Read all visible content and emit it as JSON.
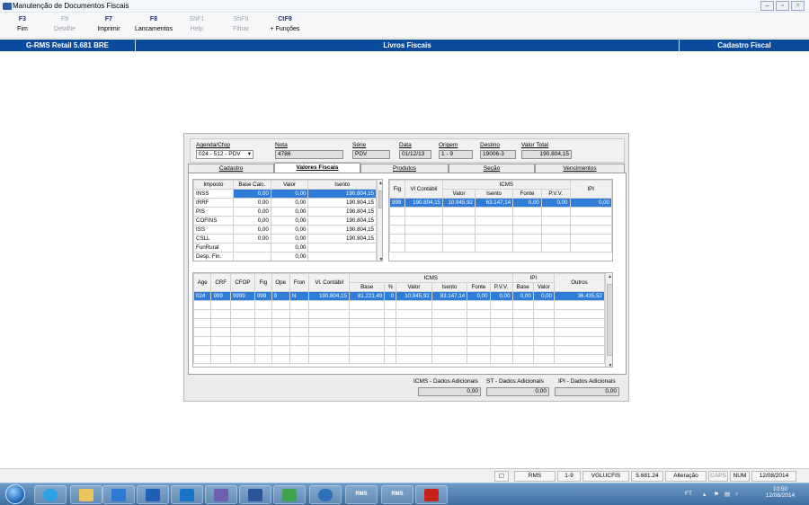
{
  "window": {
    "title": "Manutenção de Documentos Fiscais"
  },
  "fkeys": [
    {
      "key": "F3",
      "label": "Fim",
      "enabled": true
    },
    {
      "key": "F9",
      "label": "Detalhe",
      "enabled": false
    },
    {
      "key": "F7",
      "label": "Imprimir",
      "enabled": true
    },
    {
      "key": "F8",
      "label": "Lancamentos",
      "enabled": true
    },
    {
      "key": "ShF1",
      "label": "Help",
      "enabled": false
    },
    {
      "key": "ShF9",
      "label": "Filtrar",
      "enabled": false
    },
    {
      "key": "CtF9",
      "label": "+ Funções",
      "enabled": true
    }
  ],
  "bluebar": {
    "left": "G-RMS Retail 5.681 BRE",
    "center": "Livros Fiscais",
    "right": "Cadastro Fiscal"
  },
  "header": {
    "agenda_label": "Agenda/Cfop",
    "agenda_value": "024 - 512 - PDV",
    "nota_label": "Nota",
    "nota_value": "4786",
    "serie_label": "Série",
    "serie_value": "PDV",
    "data_label": "Data",
    "data_value": "01/12/13",
    "origem_label": "Origem",
    "origem_value": "1 - 9",
    "destino_label": "Destino",
    "destino_value": "19006-3",
    "valor_label": "Valor Total",
    "valor_value": "190.804,15"
  },
  "tabs": [
    {
      "label": "Cadastro",
      "active": false
    },
    {
      "label": "Valores Fiscais",
      "active": true
    },
    {
      "label": "Produtos",
      "active": false
    },
    {
      "label": "Seção",
      "active": false
    },
    {
      "label": "Vencimentos",
      "active": false
    }
  ],
  "impostos": {
    "headers": [
      "Imposto",
      "Base Calc.",
      "Valor",
      "Isento"
    ],
    "rows": [
      [
        "INSS",
        "0,00",
        "0,00",
        "190.804,15"
      ],
      [
        "IRRF",
        "0,00",
        "0,00",
        "190.804,15"
      ],
      [
        "PIS",
        "0,00",
        "0,00",
        "190.804,15"
      ],
      [
        "COFINS",
        "0,00",
        "0,00",
        "190.804,15"
      ],
      [
        "ISS",
        "0,00",
        "0,00",
        "190.804,15"
      ],
      [
        "CSLL",
        "0,00",
        "0,00",
        "190.804,15"
      ],
      [
        "FunRural",
        "",
        "0,00",
        ""
      ],
      [
        "Desp. Fin.",
        "",
        "0,00",
        ""
      ]
    ]
  },
  "icms_top": {
    "headers": {
      "fig": "Fig",
      "vl": "Vl Contábil",
      "icms": "ICMS",
      "ipi": "IPI"
    },
    "subheaders": [
      "Valor",
      "Isento",
      "Fonte",
      "P.V.V."
    ],
    "row": [
      "999",
      "190.804,15",
      "10.945,92",
      "63.147,14",
      "0,00",
      "0,00",
      "0,00"
    ]
  },
  "bottom": {
    "headers": [
      "Age",
      "CRF",
      "CFOP",
      "Fig",
      "Ope",
      "Fron",
      "Vl. Contábil"
    ],
    "icms_label": "ICMS",
    "icms_sub": [
      "Base",
      "%",
      "Valor",
      "Isento",
      "Fonte",
      "P.V.V."
    ],
    "ipi_label": "IPI",
    "ipi_sub": [
      "Base",
      "Valor"
    ],
    "outros_label": "Outros",
    "row": [
      "024",
      "999",
      "9999",
      "999",
      "9",
      "N",
      "190.804,15",
      "81.221,49",
      "0",
      "10.945,92",
      "83.147,14",
      "0,00",
      "0,00",
      "0,00",
      "0,00",
      "36.435,52"
    ]
  },
  "footer": {
    "icms_label": "ICMS - Dados Adicionais",
    "icms_value": "0,00",
    "st_label": "ST - Dados Adicionais",
    "st_value": "0,00",
    "ipi_label": "IPI - Dados Adicionais",
    "ipi_value": "0,00"
  },
  "statusbar": [
    "RMS",
    "1-9",
    "VGLUCFIS",
    "5.681.24",
    "Alteração",
    "CAPS",
    "NUM",
    "12/08/2014"
  ],
  "taskbar": {
    "label_a": "RMS",
    "label_b": "RMS",
    "tray_lang": "FT",
    "time": "10:50",
    "date": "12/08/2014"
  }
}
